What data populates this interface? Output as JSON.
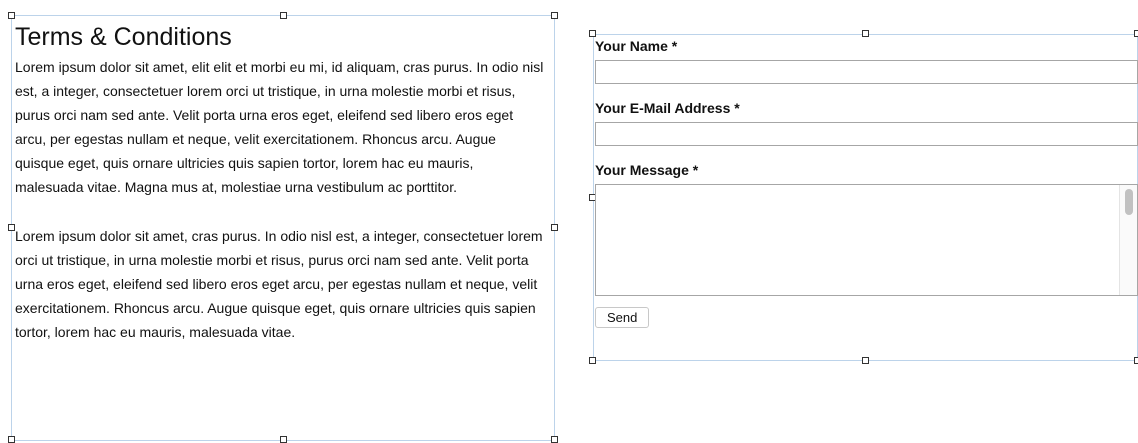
{
  "terms": {
    "title": "Terms & Conditions",
    "paragraphs": [
      "Lorem ipsum dolor sit amet, elit elit et morbi eu mi, id aliquam, cras purus. In odio nisl est, a integer, consectetuer lorem orci ut tristique, in urna molestie morbi et risus, purus orci nam sed ante. Velit porta urna eros eget, eleifend sed libero eros eget arcu, per egestas nullam et neque, velit exercitationem. Rhoncus arcu. Augue quisque eget, quis ornare ultricies quis sapien tortor, lorem hac eu mauris, malesuada vitae. Magna mus at, molestiae urna vestibulum ac porttitor.",
      "Lorem ipsum dolor sit amet, cras purus. In odio nisl est, a integer, consectetuer lorem orci ut tristique, in urna molestie morbi et risus, purus orci nam sed ante. Velit porta urna eros eget, eleifend sed libero eros eget arcu, per egestas nullam et neque, velit exercitationem. Rhoncus arcu. Augue quisque eget, quis ornare ultricies quis sapien tortor, lorem hac eu mauris, malesuada vitae."
    ]
  },
  "form": {
    "name_label": "Your Name *",
    "name_value": "",
    "email_label": "Your E-Mail Address *",
    "email_value": "",
    "message_label": "Your Message *",
    "message_value": "",
    "send_label": "Send"
  },
  "colors": {
    "frame_border": "#bcd3ea",
    "handle_border": "#333333",
    "input_border": "#a6a6a6"
  }
}
